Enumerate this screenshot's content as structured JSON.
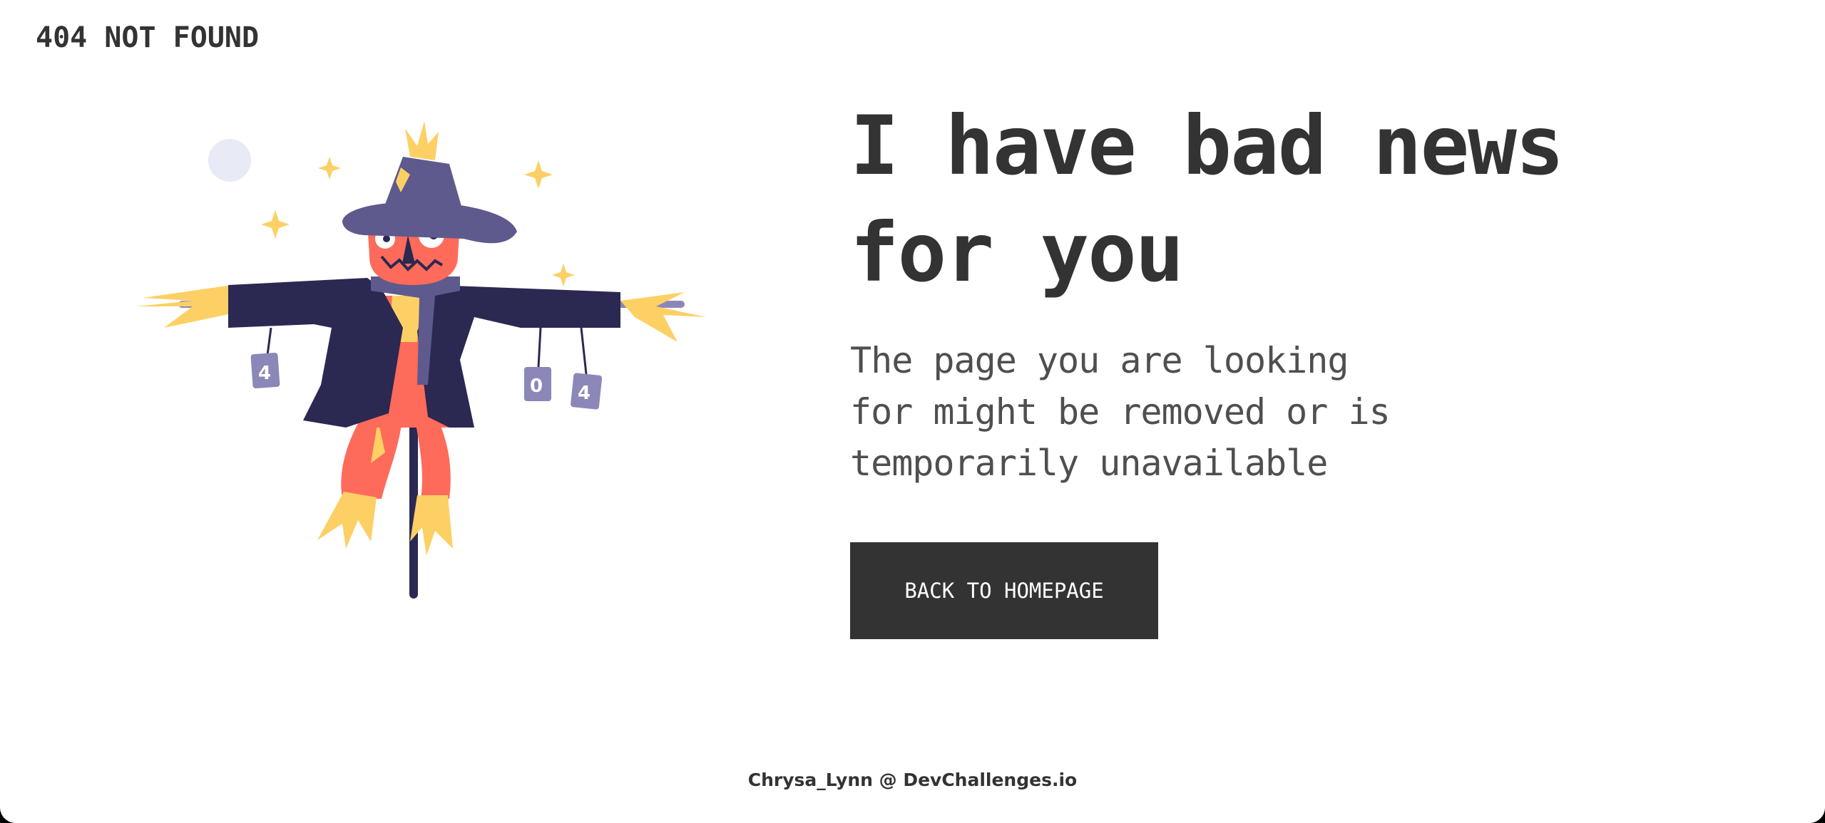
{
  "header": {
    "brand": "404 NOT FOUND"
  },
  "illustration": {
    "name": "scarecrow",
    "can_labels": [
      "4",
      "0",
      "4"
    ]
  },
  "main": {
    "headline": "I have bad news for you",
    "message": "The page you are looking for might be removed or is temporarily unavailable",
    "button_label": "BACK TO HOMEPAGE"
  },
  "footer": {
    "credit": "Chrysa_Lynn @ DevChallenges.io"
  },
  "colors": {
    "text": "#333333",
    "button_bg": "#333333",
    "button_text": "#ffffff",
    "coat": "#2b2852",
    "hat": "#5e5a8e",
    "face": "#fe6b5b",
    "straw": "#fdd065",
    "moon": "#e8eaf6"
  }
}
